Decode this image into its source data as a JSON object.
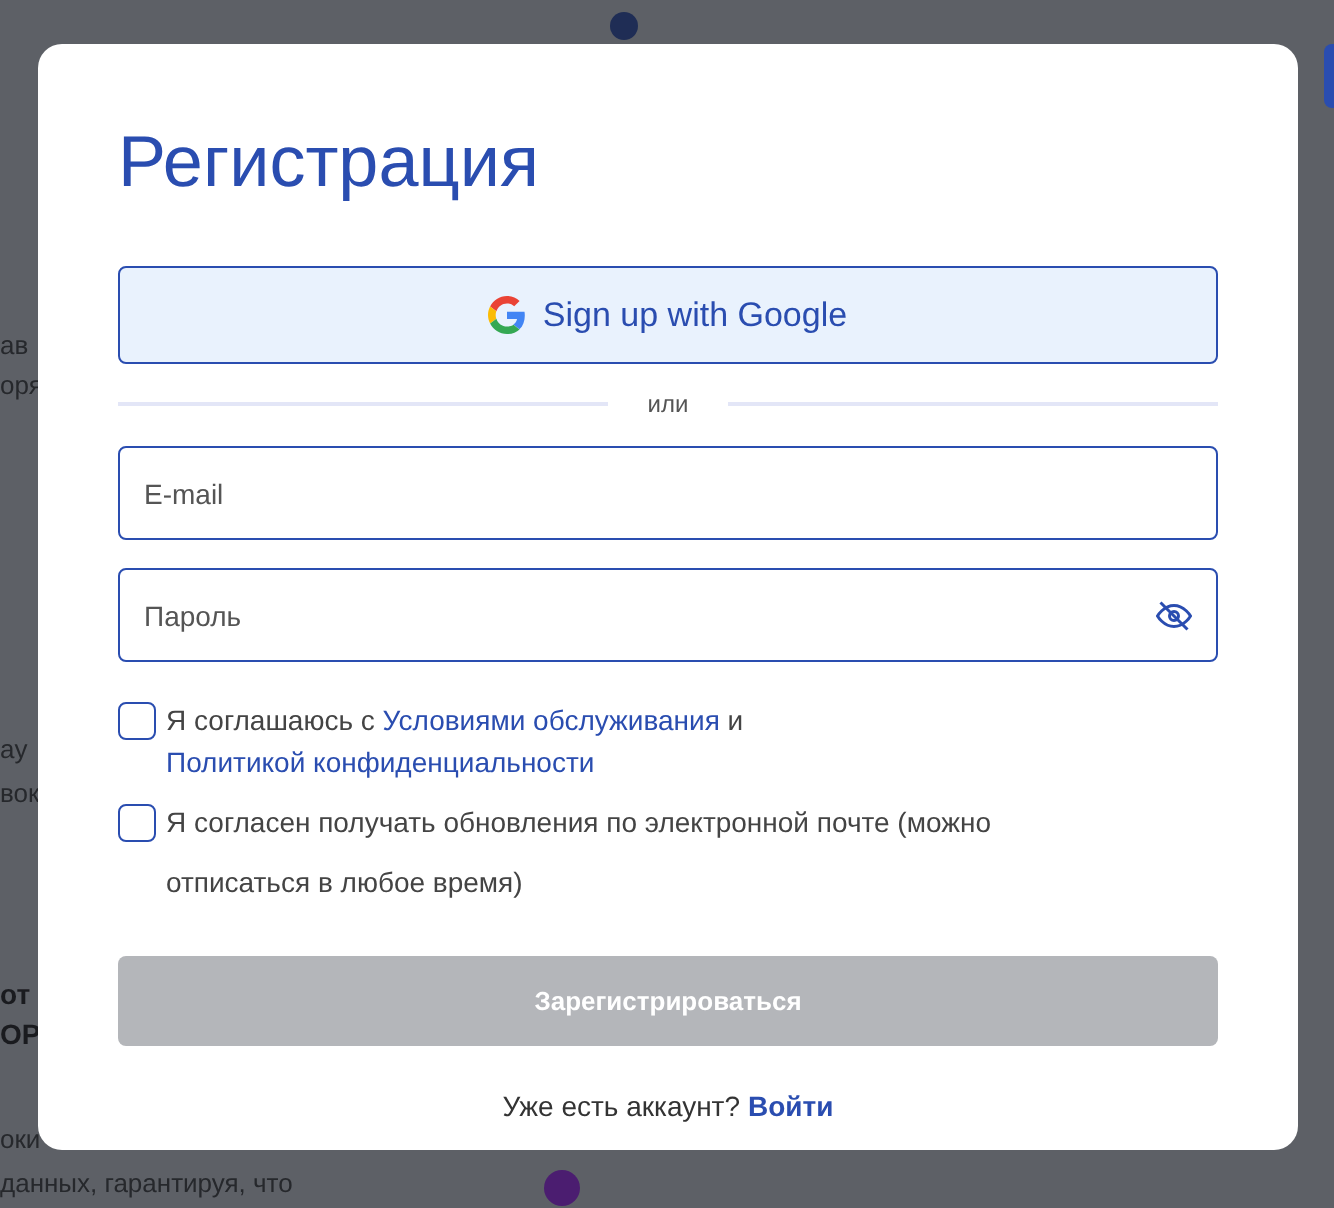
{
  "background_page": {
    "fragments": [
      {
        "text": "ав",
        "kind": "body"
      },
      {
        "text": "оря",
        "kind": "body"
      },
      {
        "text": "ay",
        "kind": "body"
      },
      {
        "text": "вок",
        "kind": "body"
      },
      {
        "text": "от",
        "kind": "bold"
      },
      {
        "text": "ОР",
        "kind": "bold"
      },
      {
        "text": "оки",
        "kind": "body"
      },
      {
        "text": "данных, гарантируя, что",
        "kind": "body"
      }
    ]
  },
  "dialog": {
    "title": "Регистрация",
    "google_button": "Sign up with Google",
    "separator": "или",
    "email": {
      "placeholder": "E-mail"
    },
    "password": {
      "placeholder": "Пароль"
    },
    "consents": [
      {
        "segments": [
          {
            "text": "Я соглашаюсь с ",
            "kind": "plain"
          },
          {
            "text": "Условиями обслуживания",
            "kind": "link"
          },
          {
            "text": " и ",
            "kind": "plain"
          },
          {
            "text": "Политикой конфиденциальности",
            "kind": "link"
          }
        ],
        "checked": false
      },
      {
        "segments": [
          {
            "text": "Я согласен получать обновления по электронной почте (можно отписаться в любое время)",
            "kind": "plain"
          }
        ],
        "checked": false
      }
    ],
    "submit": {
      "label": "Зарегистрироваться",
      "disabled": true
    },
    "footer": {
      "text": "Уже есть аккаунт?",
      "link": "Войти"
    }
  }
}
